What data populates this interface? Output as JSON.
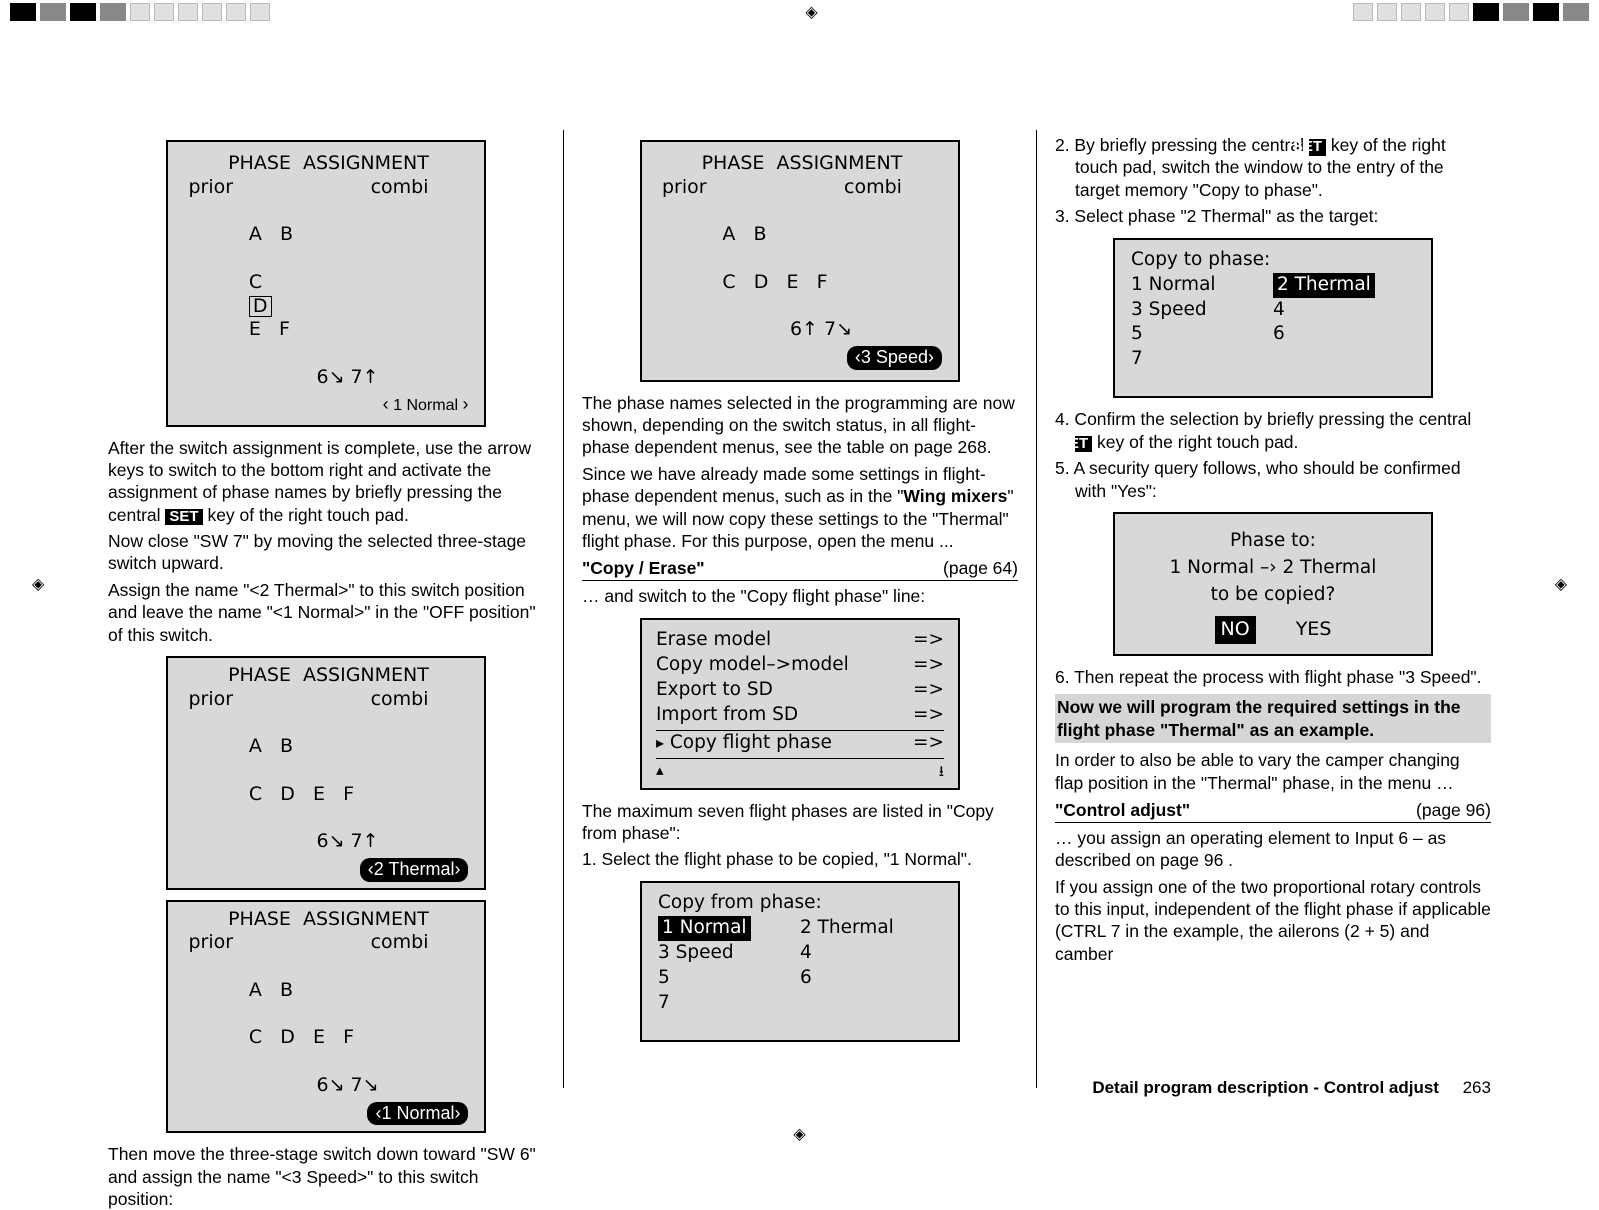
{
  "marks": {
    "reg": "◈"
  },
  "col1": {
    "lcd1": {
      "title": "PHASE  ASSIGNMENT",
      "row2_left": "prior",
      "row2_right": "combi",
      "row3_left": "A   B",
      "row3_c": "C",
      "row3_d": "D",
      "row3_ef": "E   F",
      "row4": "6↘ 7↑",
      "tag": "1 Normal",
      "l": "‹",
      "r": "›"
    },
    "p1": "After the switch assignment is complete, use the arrow keys to switch to the bottom right and activate the assignment of phase names by briefly pressing the central ",
    "p1b": " key of the right touch pad.",
    "set": "SET",
    "p2": "Now close \"SW 7\" by moving the selected three-stage switch upward.",
    "p3": "Assign the name \"<2 Thermal>\" to this switch position and leave the name \"<1 Normal>\" in the \"OFF position\" of this switch.",
    "lcd2": {
      "row4": "6↘ 7↑",
      "tag": "2 Thermal"
    },
    "lcd3": {
      "row4": "6↘ 7↘",
      "tag": "1 Normal"
    },
    "p4": "Then move the three-stage switch down toward \"SW 6\" and assign the name \"<3 Speed>\" to this switch position:"
  },
  "col2": {
    "lcd1": {
      "row4": "6↑ 7↘",
      "tag": "3 Speed"
    },
    "p1": "The phase names selected in the programming are now shown, depending on the switch status, in all flight-phase dependent menus, see the table on page 268.",
    "p2a": "Since we have already made some settings in flight-phase dependent menus, such  as in the \"",
    "p2b": "Wing mixers",
    "p2c": "\" menu, we will now copy these settings to the \"Thermal\" flight phase. For this purpose, open the menu ...",
    "section1_l": "\"Copy / Erase\"",
    "section1_r": "(page 64)",
    "p3": "… and switch to the \"Copy flight phase\" line:",
    "menu": {
      "r1": "Erase model",
      "r2": "Copy model–>model",
      "r3": "Export to SD",
      "r4": "Import from SD",
      "r5": "Copy flight phase",
      "arrow": "=>",
      "tri": "▸",
      "up": "▴",
      "dl": "⭳"
    },
    "p4": "The maximum seven flight phases are listed in \"Copy from phase\":",
    "ol1": "1.  Select the flight phase to be copied, \"1 Normal\".",
    "copyfrom": {
      "title": "Copy  from  phase:",
      "r1a": "1 Normal",
      "r1b": "2 Thermal",
      "r2a": "3 Speed",
      "r2b": "4",
      "r3a": "5",
      "r3b": "6",
      "r4a": "7"
    }
  },
  "col3": {
    "ol2a": "2.  By briefly pressing the central ",
    "ol2b": " key of the right touch pad, switch the window to the entry of the target memory \"Copy to phase\".",
    "ol3": "3.  Select phase \"2 Thermal\" as the target:",
    "copyto": {
      "title": "Copy  to  phase:",
      "r1a": "1 Normal",
      "r1b": "2 Thermal",
      "r2a": "3 Speed",
      "r2b": "4",
      "r3a": "5",
      "r3b": "6",
      "r4a": "7"
    },
    "ol4a": "4.  Confirm the selection by briefly pressing the central ",
    "ol4b": " key of the right touch pad.",
    "ol5": "5.  A security query follows, who should be confirmed with \"Yes\":",
    "confirm": {
      "l1": "Phase   to:",
      "l2": "1 Normal   –›  2 Thermal",
      "l3": "to  be  copied?",
      "no": "NO",
      "yes": "YES"
    },
    "ol6": "6.  Then repeat the process with flight phase \"3 Speed\".",
    "hl": "Now we will program the required settings in the flight phase \"Thermal\" as an example.",
    "p1": "In order to also be able to vary the camper changing flap position in the \"Thermal\" phase, in the menu …",
    "section2_l": "\"Control adjust\"",
    "section2_r": "(page 96)",
    "p2": "… you assign an operating element to Input 6 – as described on page 96 .",
    "p3": "If you assign one of the two proportional rotary controls to this input, independent of the flight phase if applicable (CTRL 7 in the example, the ailerons (2 + 5) and camber",
    "footer_a": "Detail program description - Control adjust",
    "footer_b": "263"
  },
  "set": "SET"
}
